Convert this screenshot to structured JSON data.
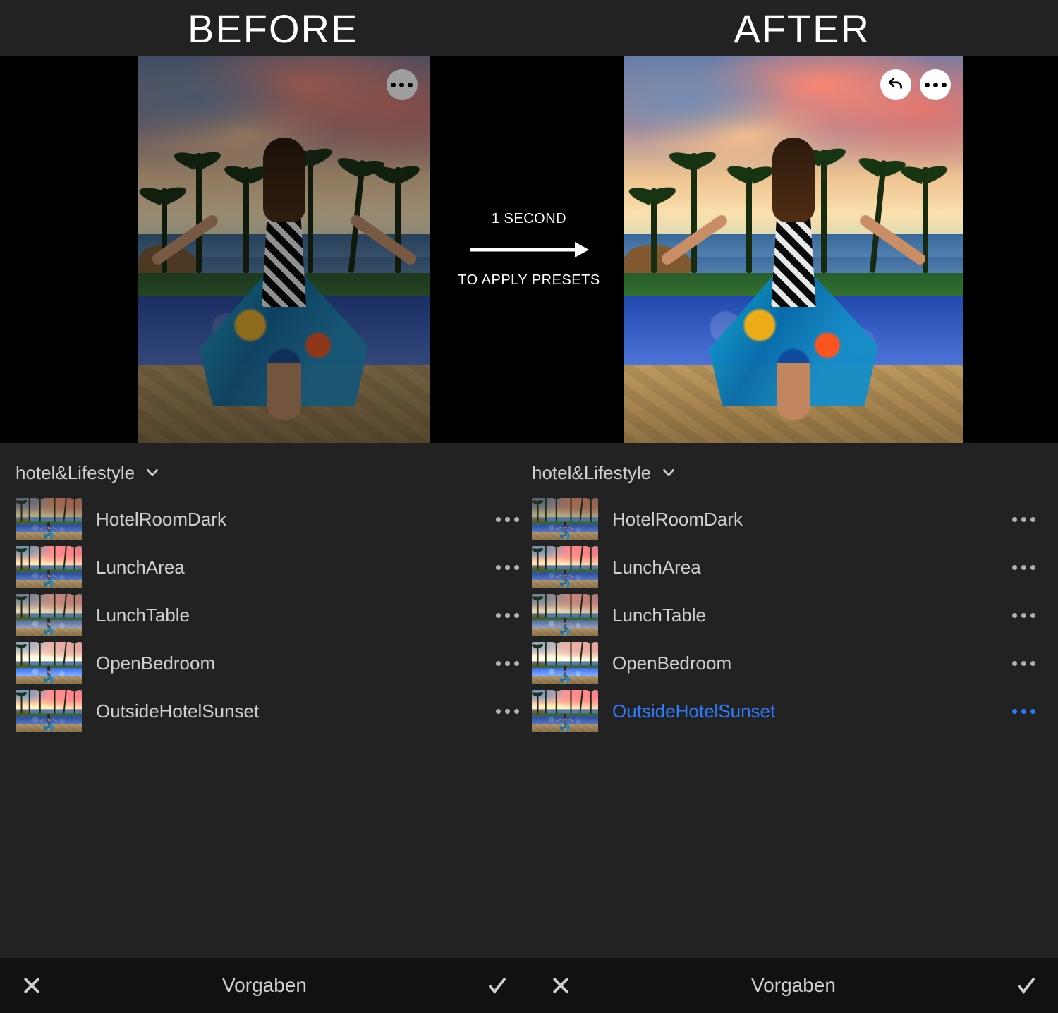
{
  "titles": {
    "before": "BEFORE",
    "after": "AFTER"
  },
  "overlay": {
    "line1": "1 SECOND",
    "line2": "TO APPLY PRESETS"
  },
  "group": {
    "name": "hotel&Lifestyle"
  },
  "presets": [
    {
      "name": "HotelRoomDark"
    },
    {
      "name": "LunchArea"
    },
    {
      "name": "LunchTable"
    },
    {
      "name": "OpenBedroom"
    },
    {
      "name": "OutsideHotelSunset"
    }
  ],
  "panelFooter": {
    "title": "Vorgaben"
  },
  "after": {
    "selectedIndex": 4
  }
}
